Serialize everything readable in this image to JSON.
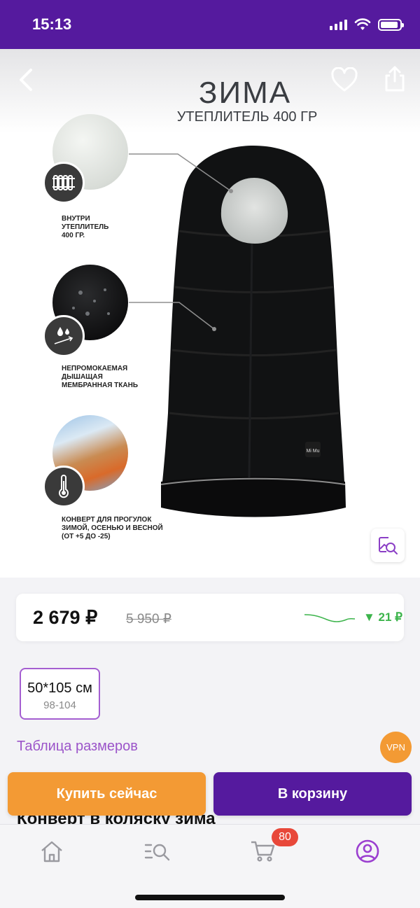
{
  "status_bar": {
    "time": "15:13"
  },
  "product_image": {
    "headline": "ЗИМА",
    "subheadline": "УТЕПЛИТЕЛЬ 400 ГР",
    "features": [
      {
        "text": "ВНУТРИ\nУТЕПЛИТЕЛЬ\n400 ГР.",
        "icon": "radiator-icon"
      },
      {
        "text": "НЕПРОМОКАЕМАЯ\nДЫШАЩАЯ\nМЕМБРАННАЯ ТКАНЬ",
        "icon": "water-drops-icon"
      },
      {
        "text": "КОНВЕРТ ДЛЯ ПРОГУЛОК\nЗИМОЙ, ОСЕНЬЮ И ВЕСНОЙ\n(ОТ +5 ДО -25)",
        "icon": "thermometer-icon"
      }
    ],
    "brand_patch": "Mi Mu"
  },
  "price": {
    "current": "2 679 ₽",
    "old": "5 950 ₽",
    "drop": "▼ 21 ₽",
    "drop_color": "#3cb44b"
  },
  "size_options": [
    {
      "label": "50*105 см",
      "sub": "98-104",
      "selected": true
    }
  ],
  "size_table_link": "Таблица размеров",
  "vpn_badge": "VPN",
  "product_title": "Конверт в коляску зима",
  "actions": {
    "buy_now": "Купить сейчас",
    "add_to_cart": "В корзину"
  },
  "tab_bar": {
    "items": [
      {
        "name": "home",
        "icon": "home-icon"
      },
      {
        "name": "catalog-search",
        "icon": "search-list-icon"
      },
      {
        "name": "cart",
        "icon": "cart-icon",
        "badge": "80"
      },
      {
        "name": "profile",
        "icon": "profile-icon",
        "active": true
      }
    ]
  },
  "colors": {
    "brand_purple": "#551a9e",
    "accent_orange": "#f39a34",
    "link_purple": "#9b54c9",
    "badge_red": "#e8483a"
  }
}
